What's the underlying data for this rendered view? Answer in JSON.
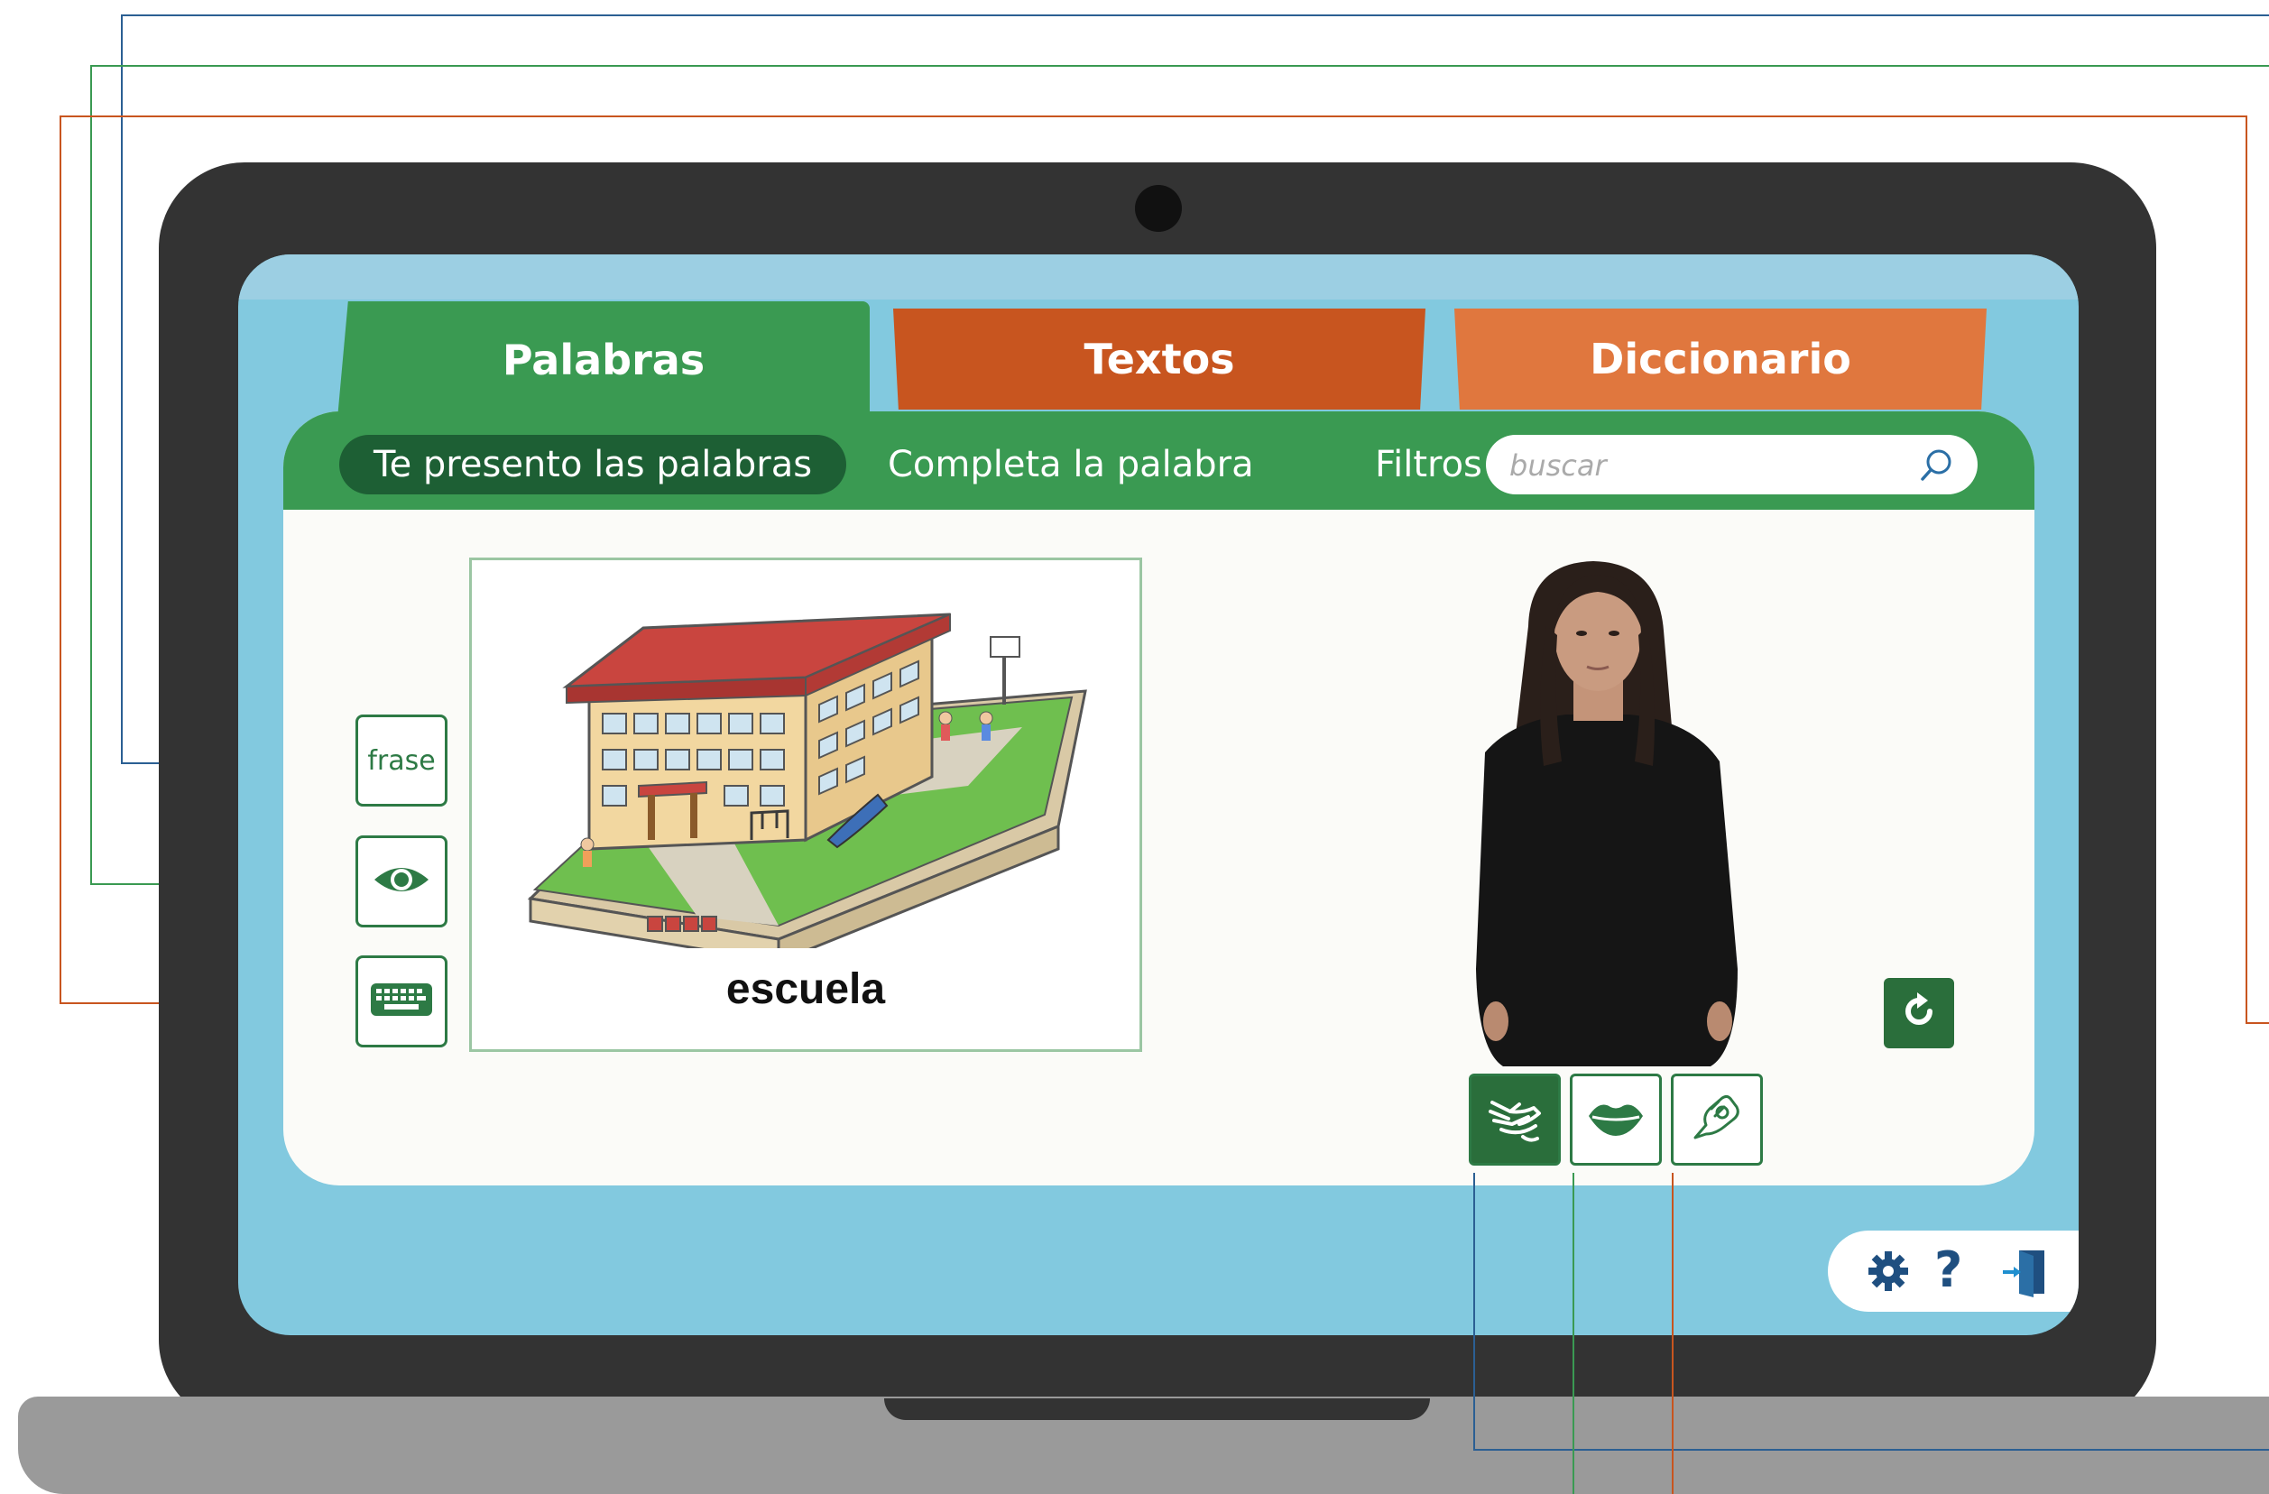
{
  "tabs": [
    {
      "label": "Palabras",
      "active": true
    },
    {
      "label": "Textos",
      "active": false
    },
    {
      "label": "Diccionario",
      "active": false
    }
  ],
  "subnav": {
    "active": "Te presento las palabras",
    "complete": "Completa la palabra",
    "filters": "Filtros"
  },
  "search": {
    "placeholder": "buscar",
    "icon": "search-icon"
  },
  "side_buttons": {
    "phrase_label": "frase",
    "eye_icon": "eye-icon",
    "keyboard_icon": "keyboard-icon"
  },
  "word_card": {
    "word": "escuela",
    "illustration": "school-illustration"
  },
  "sign_video": {
    "description_icon": "sign-language-video"
  },
  "mode_buttons": [
    {
      "icon": "sign-hands-icon",
      "active": true
    },
    {
      "icon": "lips-icon",
      "active": false
    },
    {
      "icon": "fingerspelling-hand-icon",
      "active": false
    }
  ],
  "replay_icon": "replay-icon",
  "toolbar": {
    "settings_icon": "gear-icon",
    "help_label": "?",
    "exit_icon": "exit-door-icon"
  },
  "colors": {
    "green": "#3a9a52",
    "dark_green": "#1d5f34",
    "orange_dark": "#c8551f",
    "orange": "#e0773e",
    "screen_bg": "#82c9df",
    "line_blue": "#2b5f93",
    "line_green": "#3a9a52",
    "line_orange": "#c8551f"
  }
}
